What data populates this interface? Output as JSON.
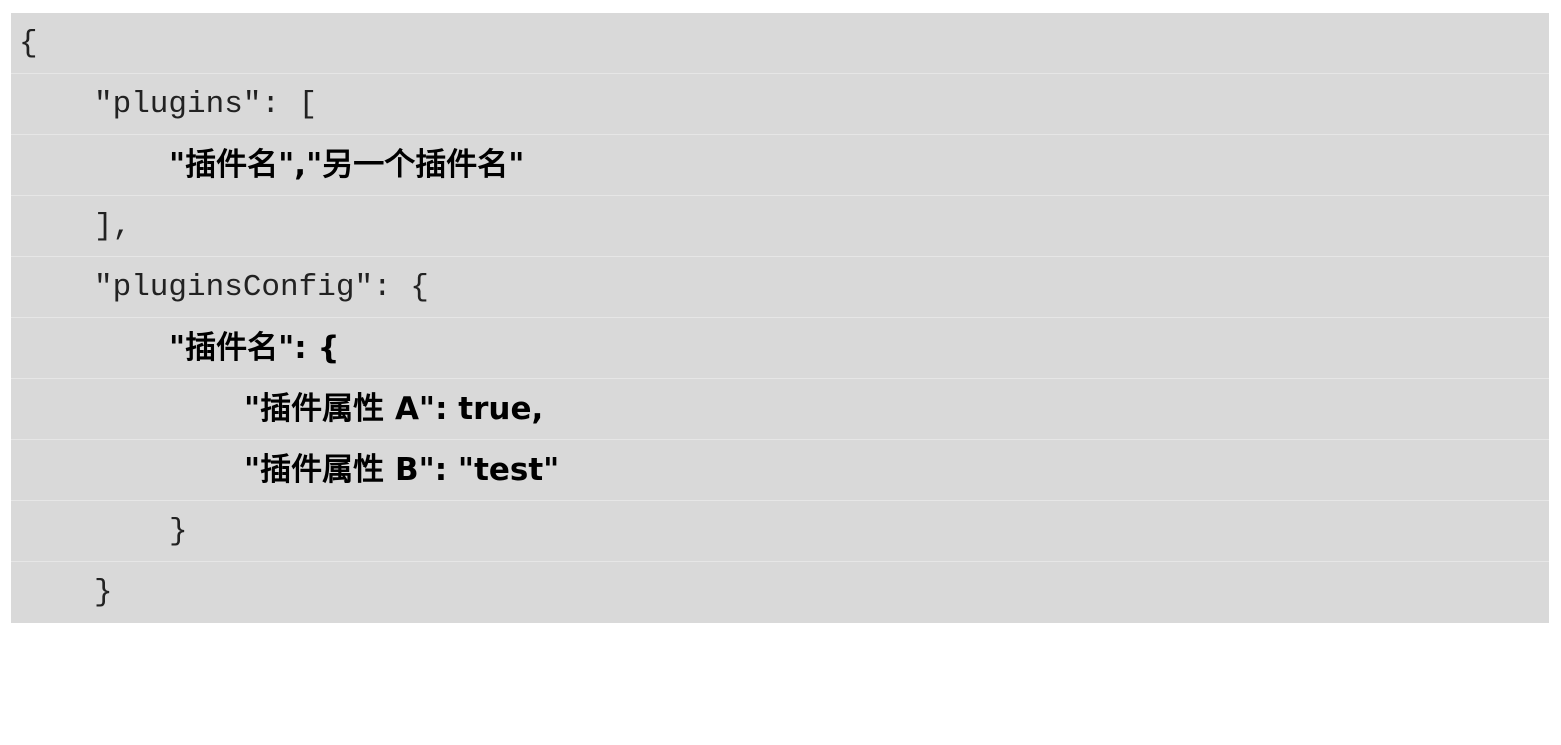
{
  "code_block": {
    "lines": [
      "{",
      "\"plugins\": [",
      "\"插件名\",\"另一个插件名\"",
      "],",
      "\"pluginsConfig\": {",
      "\"插件名\": {",
      "\"插件属性 A\": true,",
      "\"插件属性 B\": \"test\"",
      "}",
      "}"
    ]
  }
}
